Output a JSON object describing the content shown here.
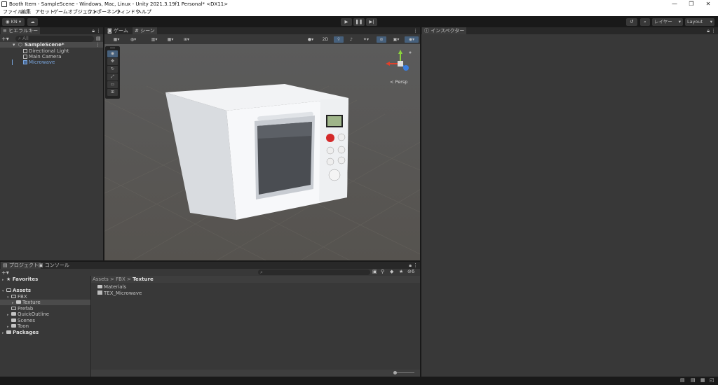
{
  "window": {
    "title": "Booth Item - SampleScene - Windows, Mac, Linux - Unity 2021.3.19f1 Personal* <DX11>",
    "min": "—",
    "max": "❐",
    "close": "✕"
  },
  "menu": [
    "ファイル",
    "編集",
    "アセット",
    "ゲームオブジェクト",
    "コンポーネント",
    "ウィンドウ",
    "ヘルプ"
  ],
  "toolbar": {
    "account": "KN",
    "layers": "レイヤー",
    "layout": "Layout"
  },
  "hierarchy": {
    "tab": "ヒエラルキー",
    "search_placeholder": "All",
    "scene": "SampleScene*",
    "items": [
      "Directional Light",
      "Main Camera",
      "Microwave"
    ]
  },
  "scene_view": {
    "tabs": [
      "ゲーム",
      "シーン"
    ],
    "mode_2d": "2D",
    "persp": "Persp"
  },
  "inspector": {
    "tab": "インスペクター"
  },
  "project": {
    "tabs": [
      "プロジェクト",
      "コンソール"
    ],
    "hidden_count": "6",
    "favorites": "Favorites",
    "assets": "Assets",
    "tree": [
      "FBX",
      "Texture",
      "Prefab",
      "QuickOutline",
      "Scenes",
      "Toon"
    ],
    "packages": "Packages",
    "breadcrumb": [
      "Assets",
      "FBX",
      "Texture"
    ],
    "files": [
      "Materials",
      "TEX_Microwave"
    ]
  },
  "colors": {
    "accent": "#46607c",
    "selected": "#7aa7e0",
    "bg": "#383838"
  }
}
